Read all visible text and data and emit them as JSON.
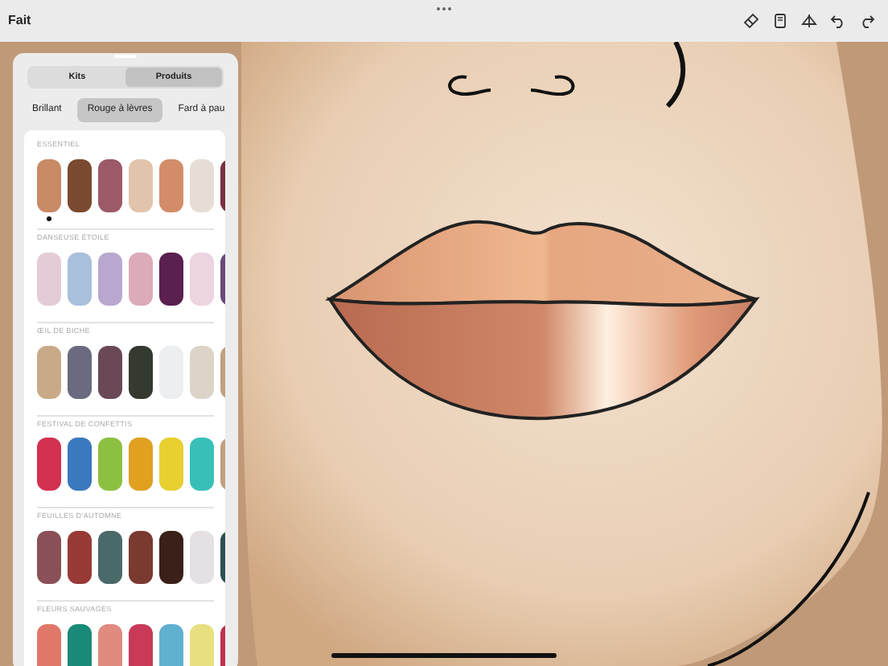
{
  "toolbar": {
    "done_label": "Fait"
  },
  "segments": [
    {
      "label": "Kits",
      "selected": false
    },
    {
      "label": "Produits",
      "selected": true
    }
  ],
  "tabs": [
    {
      "label": "Brillant",
      "selected": false
    },
    {
      "label": "Rouge à lèvres",
      "selected": true
    },
    {
      "label": "Fard à pau",
      "selected": false
    }
  ],
  "collections": [
    {
      "title": "ESSENTIEL",
      "swatches": [
        {
          "color": "#c98a66",
          "selected": true
        },
        {
          "color": "#7a4a30",
          "selected": false
        },
        {
          "color": "#9c5a68",
          "selected": false
        },
        {
          "color": "#e2c4ac",
          "selected": false
        },
        {
          "color": "#d38c6a",
          "selected": false
        },
        {
          "color": "#e6ded4",
          "selected": false
        },
        {
          "color": "#7a3040"
        }
      ]
    },
    {
      "title": "DANSEUSE ÉTOILE",
      "swatches": [
        {
          "color": "#e4ccd6",
          "selected": false
        },
        {
          "color": "#a8c0dc",
          "selected": false
        },
        {
          "color": "#b8a8d0",
          "selected": false
        },
        {
          "color": "#dcaab8",
          "selected": false
        },
        {
          "color": "#5a2050",
          "selected": false
        },
        {
          "color": "#ecd4e0",
          "selected": false
        },
        {
          "color": "#6a4a7a"
        }
      ]
    },
    {
      "title": "ŒIL DE BICHE",
      "swatches": [
        {
          "color": "#c8aa88",
          "selected": false
        },
        {
          "color": "#6a6a80",
          "selected": false
        },
        {
          "color": "#6a4858",
          "selected": false
        },
        {
          "color": "#343a30",
          "selected": false
        },
        {
          "color": "#eceef0",
          "selected": false
        },
        {
          "color": "#dcd4c8",
          "selected": false
        },
        {
          "color": "#c0a080"
        }
      ]
    },
    {
      "title": "FESTIVAL DE CONFETTIS",
      "swatches": [
        {
          "color": "#d43050",
          "selected": false
        },
        {
          "color": "#3a78c0",
          "selected": false
        },
        {
          "color": "#8cc040",
          "selected": false
        },
        {
          "color": "#e0a020",
          "selected": false
        },
        {
          "color": "#e8d030",
          "selected": false
        },
        {
          "color": "#38c0b8",
          "selected": false
        },
        {
          "color": "#c0a080"
        }
      ]
    },
    {
      "title": "FEUILLES D'AUTOMNE",
      "swatches": [
        {
          "color": "#8a5058",
          "selected": false
        },
        {
          "color": "#983a36",
          "selected": false
        },
        {
          "color": "#4a6a6a",
          "selected": false
        },
        {
          "color": "#7a3a30",
          "selected": false
        },
        {
          "color": "#3a2018",
          "selected": false
        },
        {
          "color": "#e4e0e4",
          "selected": false
        },
        {
          "color": "#305050"
        }
      ]
    },
    {
      "title": "FLEURS SAUVAGES",
      "swatches": [
        {
          "color": "#e0786a"
        },
        {
          "color": "#1a8a78"
        },
        {
          "color": "#e08a80"
        },
        {
          "color": "#c83a58"
        },
        {
          "color": "#60b0d0"
        },
        {
          "color": "#e8e080"
        },
        {
          "color": "#c03050"
        }
      ]
    }
  ]
}
